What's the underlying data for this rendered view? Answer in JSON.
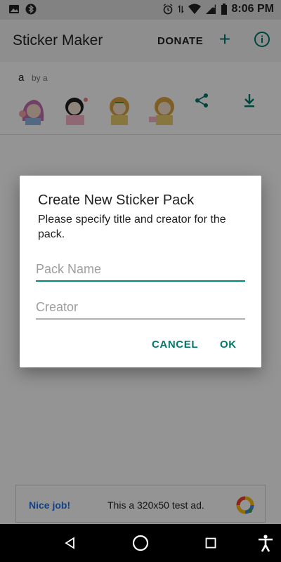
{
  "status_bar": {
    "time": "8:06 PM",
    "icons": [
      "image-icon",
      "bluetooth-icon",
      "alarm-icon",
      "data-arrows-icon",
      "wifi-icon",
      "signal-icon",
      "battery-icon"
    ]
  },
  "toolbar": {
    "title": "Sticker Maker",
    "donate_label": "DONATE",
    "add_icon": "plus-icon",
    "info_icon": "info-icon"
  },
  "pack": {
    "name": "a",
    "by": "by a",
    "share_icon": "share-icon",
    "download_icon": "download-icon"
  },
  "dialog": {
    "title": "Create New Sticker Pack",
    "message": "Please specify title and creator for the pack.",
    "pack_name_placeholder": "Pack Name",
    "pack_name_value": "",
    "creator_placeholder": "Creator",
    "creator_value": "",
    "cancel_label": "CANCEL",
    "ok_label": "OK"
  },
  "ad": {
    "title": "Nice job!",
    "text": "This a 320x50 test ad."
  },
  "colors": {
    "accent": "#00796b",
    "field_active": "#00897b",
    "ad_title": "#1a73e8"
  }
}
